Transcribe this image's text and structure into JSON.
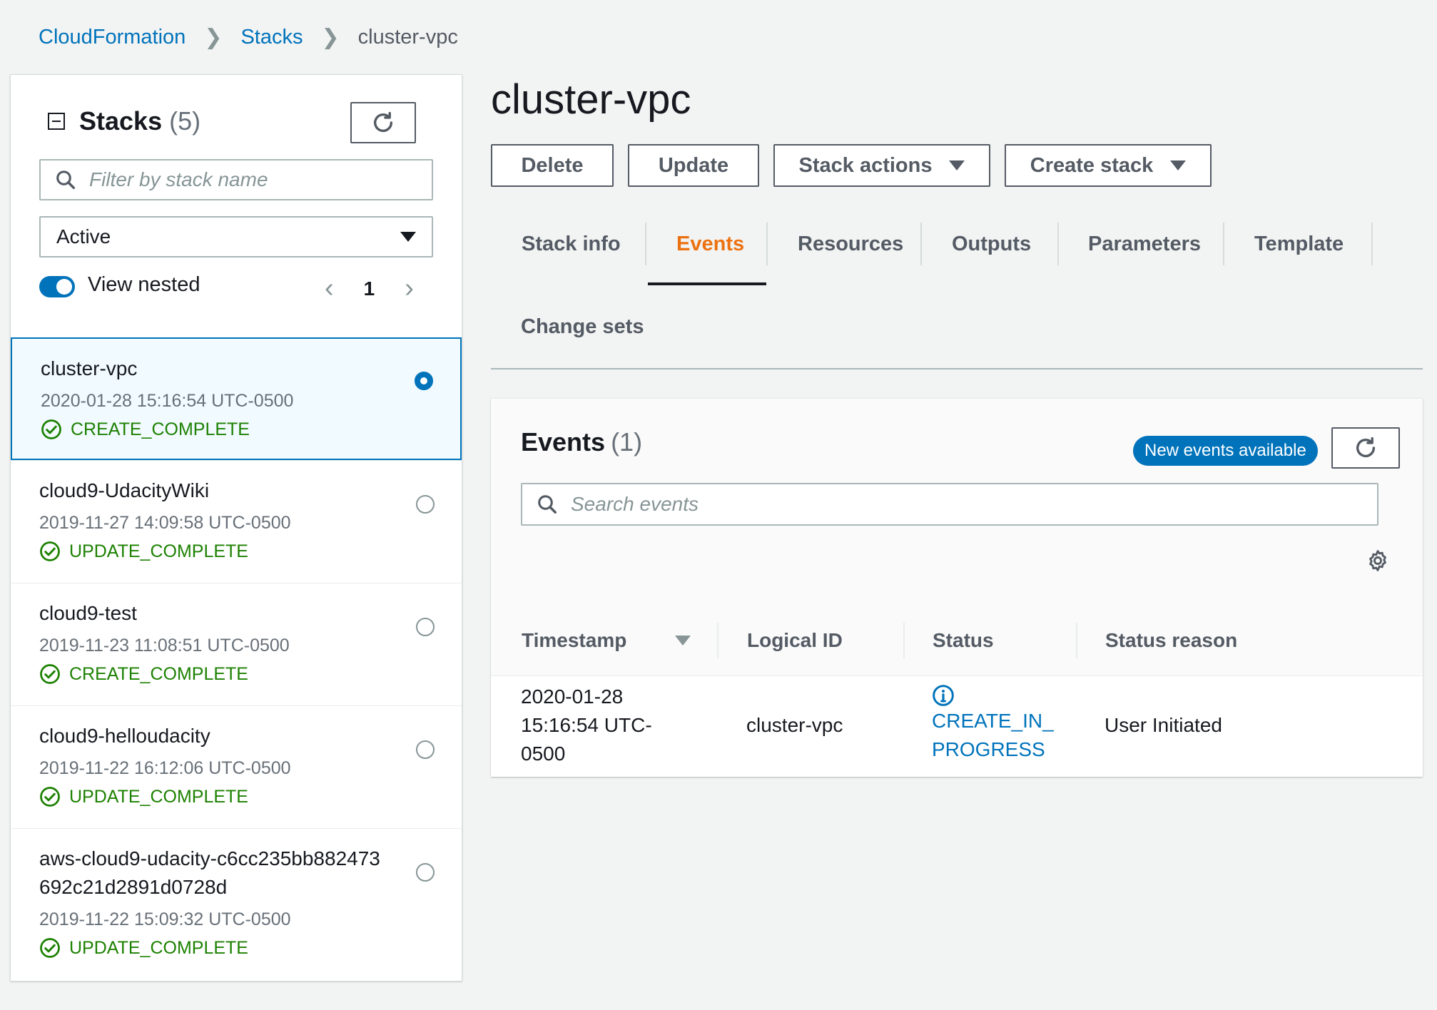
{
  "breadcrumb": {
    "items": [
      "CloudFormation",
      "Stacks"
    ],
    "current": "cluster-vpc"
  },
  "sidebar": {
    "title": "Stacks",
    "count": "(5)",
    "filter_placeholder": "Filter by stack name",
    "status_filter": "Active",
    "view_nested_label": "View nested",
    "view_nested_enabled": true,
    "page": "1",
    "stacks": [
      {
        "name": "cluster-vpc",
        "date": "2020-01-28 15:16:54 UTC-0500",
        "status": "CREATE_COMPLETE",
        "selected": true
      },
      {
        "name": "cloud9-UdacityWiki",
        "date": "2019-11-27 14:09:58 UTC-0500",
        "status": "UPDATE_COMPLETE",
        "selected": false
      },
      {
        "name": "cloud9-test",
        "date": "2019-11-23 11:08:51 UTC-0500",
        "status": "CREATE_COMPLETE",
        "selected": false
      },
      {
        "name": "cloud9-helloudacity",
        "date": "2019-11-22 16:12:06 UTC-0500",
        "status": "UPDATE_COMPLETE",
        "selected": false
      },
      {
        "name_line1": "aws-cloud9-udacity-c6cc235bb882473",
        "name_line2": "692c21d2891d0728d",
        "date": "2019-11-22 15:09:32 UTC-0500",
        "status": "UPDATE_COMPLETE",
        "selected": false
      }
    ]
  },
  "main": {
    "title": "cluster-vpc",
    "actions": {
      "delete": "Delete",
      "update": "Update",
      "stack_actions": "Stack actions",
      "create_stack": "Create stack"
    },
    "tabs": [
      "Stack info",
      "Events",
      "Resources",
      "Outputs",
      "Parameters",
      "Template",
      "Change sets"
    ],
    "active_tab": "Events"
  },
  "events": {
    "title": "Events",
    "count": "(1)",
    "new_events_label": "New events available",
    "search_placeholder": "Search events",
    "columns": [
      "Timestamp",
      "Logical ID",
      "Status",
      "Status reason"
    ],
    "rows": [
      {
        "timestamp_lines": [
          "2020-01-28",
          "15:16:54 UTC-",
          "0500"
        ],
        "logical_id": "cluster-vpc",
        "status_lines": [
          "CREATE_IN_",
          "PROGRESS"
        ],
        "status_reason": "User Initiated"
      }
    ]
  },
  "colors": {
    "link": "#0073bb",
    "success": "#1d8102",
    "active_tab": "#ec7211",
    "background": "#f2f3f3"
  }
}
